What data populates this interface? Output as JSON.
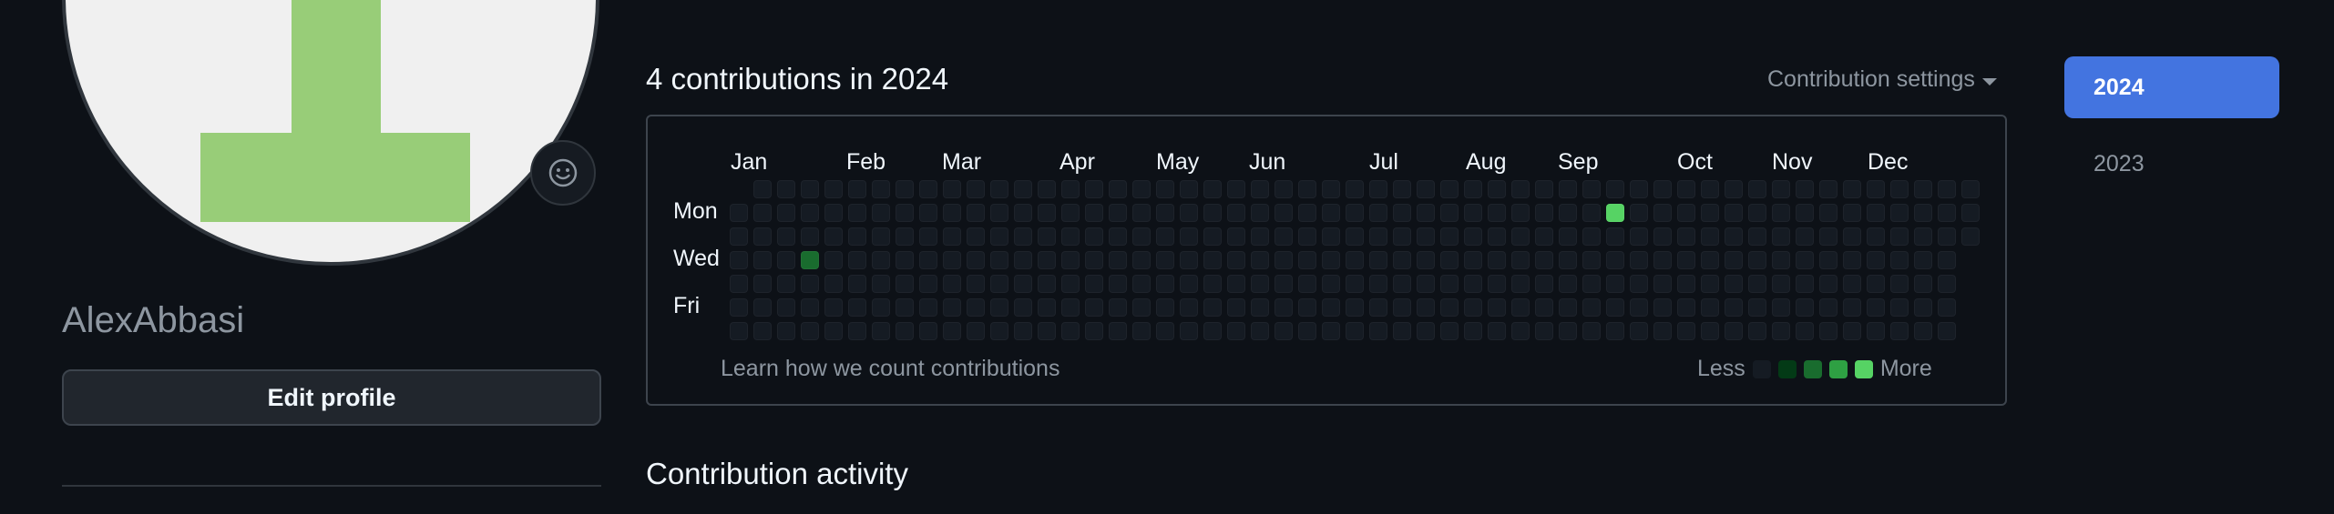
{
  "profile": {
    "username": "AlexAbbasi",
    "edit_profile_label": "Edit profile",
    "status_icon": "smiley-icon",
    "avatar_colors": {
      "background": "#f0f0f0",
      "glyph": "#98cd78"
    }
  },
  "contributions": {
    "title": "4 contributions in 2024",
    "settings_label": "Contribution settings",
    "months": [
      "Jan",
      "Feb",
      "Mar",
      "Apr",
      "May",
      "Jun",
      "Jul",
      "Aug",
      "Sep",
      "Oct",
      "Nov",
      "Dec"
    ],
    "days": [
      "Mon",
      "Wed",
      "Fri"
    ],
    "learn_link": "Learn how we count contributions",
    "legend_less": "Less",
    "legend_more": "More",
    "legend_colors": [
      "#151b23",
      "#033a16",
      "#196c2e",
      "#2ea043",
      "#56d364"
    ],
    "weeks": 53,
    "highlighted_days": [
      {
        "week": 3,
        "weekday": 3,
        "level": 2
      },
      {
        "week": 37,
        "weekday": 1,
        "level": 4
      }
    ]
  },
  "activity": {
    "title": "Contribution activity"
  },
  "years": {
    "items": [
      "2024",
      "2023"
    ],
    "selected": "2024"
  }
}
